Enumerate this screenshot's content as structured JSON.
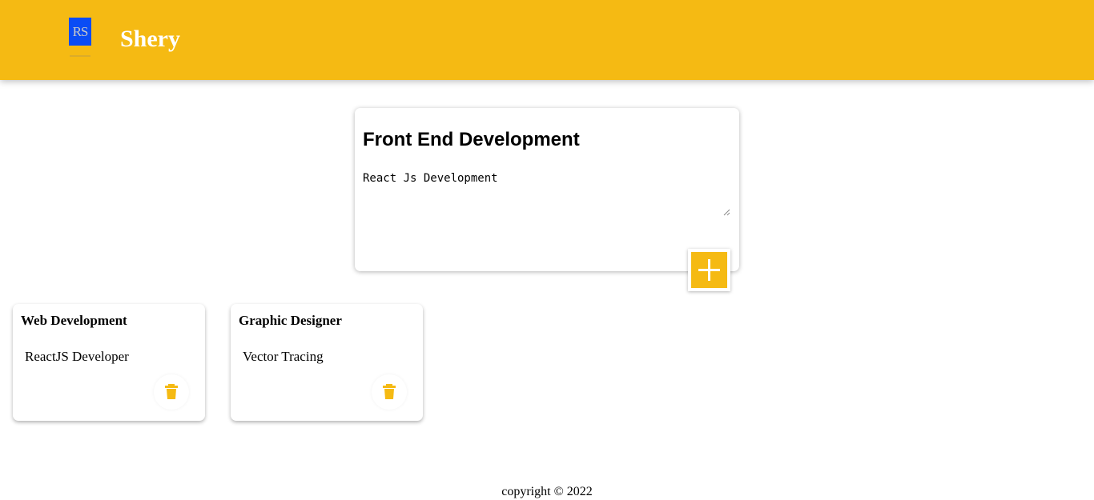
{
  "header": {
    "logo_text": "RS",
    "brand": "Shery"
  },
  "create_note": {
    "title": "Front End Development",
    "content": "React Js Development"
  },
  "notes": [
    {
      "title": "Web Development",
      "content": "ReactJS Developer"
    },
    {
      "title": "Graphic Designer",
      "content": "Vector Tracing"
    }
  ],
  "footer": {
    "copyright": "copyright © 2022"
  },
  "colors": {
    "accent": "#f5ba13",
    "logo_bg": "#0a4cf5",
    "brand_text": "#ffffff"
  },
  "icons": {
    "add": "plus-icon",
    "delete": "trash-icon"
  }
}
